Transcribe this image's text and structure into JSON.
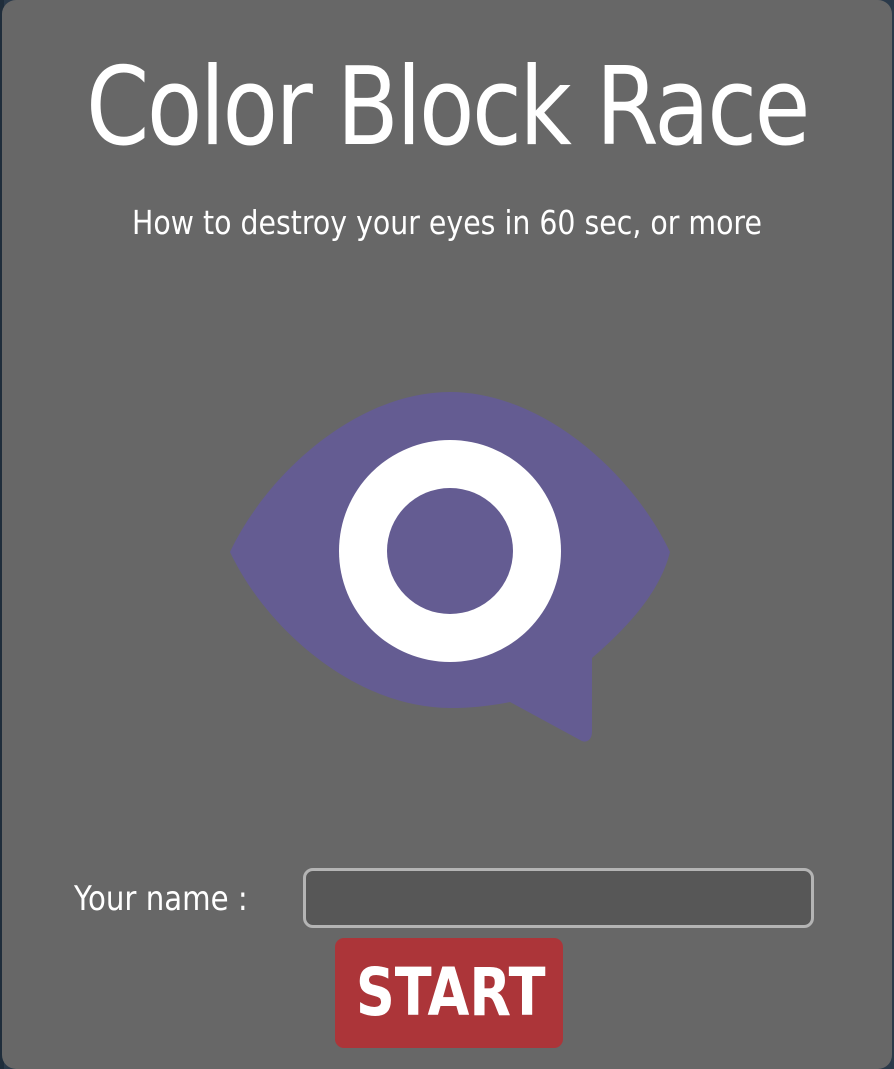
{
  "title": "Color Block Race",
  "subtitle": "How to destroy your eyes in 60 sec, or more",
  "logo": {
    "icon": "eye-speech-bubble-icon",
    "color_primary": "#645c92",
    "color_iris": "#ffffff"
  },
  "form": {
    "name_label": "Your name :",
    "name_value": "",
    "name_placeholder": "",
    "start_label": "START"
  },
  "colors": {
    "modal_background": "#676767",
    "input_background": "#575757",
    "input_border": "#b4b4b4",
    "start_button": "#ac3539",
    "text": "#ffffff"
  }
}
